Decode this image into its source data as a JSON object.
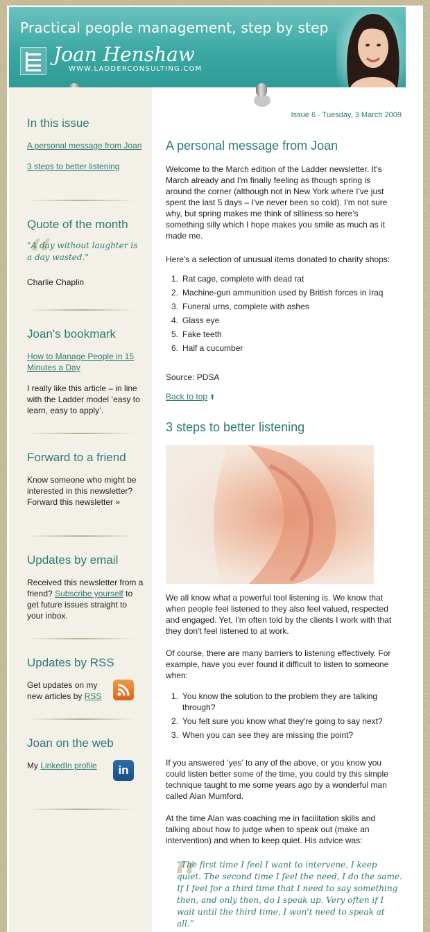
{
  "header": {
    "tagline": "Practical people management, step by step",
    "brand_name": "Joan Henshaw",
    "brand_url": "WWW.LADDERCONSULTING.COM"
  },
  "colors": {
    "accent": "#2f7a73",
    "header_teal": "#3aa8a3",
    "sidebar_bg": "#f3f0e8",
    "page_bg": "#c9bd9a"
  },
  "sidebar": {
    "in_this_issue": {
      "heading": "In this issue",
      "links": [
        "A personal message from Joan",
        "3 steps to better listening"
      ]
    },
    "quote": {
      "heading": "Quote of the month",
      "text": "\"A day without laughter is a day wasted.\"",
      "author": "Charlie Chaplin"
    },
    "bookmark": {
      "heading": "Joan's bookmark",
      "link": "How to Manage People in 15 Minutes a Day",
      "text": "I really like this article – in line with the Ladder model ‘easy to learn, easy to apply’."
    },
    "forward": {
      "heading": "Forward to a friend",
      "text": "Know someone who might be interested in this newsletter?",
      "link": "Forward this newsletter »"
    },
    "email": {
      "heading": "Updates by email",
      "text_before": "Received this newsletter from a friend?",
      "link": "Subscribe yourself",
      "text_after": "to get future issues straight to your inbox."
    },
    "rss": {
      "heading": "Updates by RSS",
      "text": "Get updates on my new articles by",
      "link": "RSS",
      "icon": "rss-icon"
    },
    "web": {
      "heading": "Joan on the web",
      "text": "My",
      "link": "LinkedIn profile",
      "icon": "linkedin-icon",
      "icon_text": "in"
    }
  },
  "main": {
    "issue_line": "Issue 6 · Tuesday, 3 March 2009",
    "article1": {
      "title": "A personal message from Joan",
      "p1": "Welcome to the March edition of the Ladder newsletter. It's March already and I'm finally feeling as though spring is around the corner (although not in New York where I've just spent the last 5 days – I've never been so cold). I'm not sure why, but spring makes me think of silliness so here's something silly which I hope makes you smile as much as it made me.",
      "p2": "Here's a selection of unusual items donated to charity shops:",
      "items": [
        "Rat cage, complete with dead rat",
        "Machine-gun ammunition used by British forces in Iraq",
        "Funeral urns, complete with ashes",
        "Glass eye",
        "Fake teeth",
        "Half a cucumber"
      ],
      "source": "Source: PDSA",
      "back_to_top": "Back to top"
    },
    "article2": {
      "title": "3 steps to better listening",
      "p1": "We all know what a powerful tool listening is. We know that when people feel listened to they also feel valued, respected and engaged. Yet, I'm often told by the clients I work with that they don't feel listened to at work.",
      "p2": "Of course, there are many barriers to listening effectively. For example, have you ever found it difficult to listen to someone when:",
      "items": [
        "You know the solution to the problem they are talking through?",
        "You felt sure you know what they're going to say next?",
        "When you can see they are missing the point?"
      ],
      "p3": "If you answered ‘yes’ to any of the above, or you know you could listen better some of the time, you could try this simple technique taught to me some years ago by a wonderful man called Alan Mumford.",
      "p4": "At the time Alan was coaching me in facilitation skills and talking about how to judge when to speak out (make an intervention) and when to keep quiet. His advice was:",
      "quote": "“The first time I feel I want to intervene, I keep quiet. The second time I feel the need, I do the same. If I feel for a third time that I need to say something then, and only then, do I speak up. Very often if I wait until the third time, I won't need to speak at all.”"
    }
  }
}
